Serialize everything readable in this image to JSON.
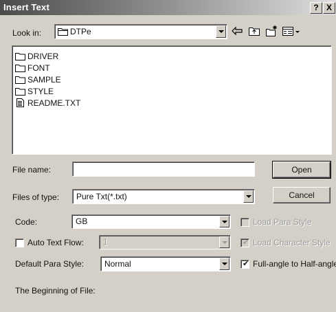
{
  "window": {
    "title": "Insert Text",
    "help_label": "?",
    "close_label": "X"
  },
  "look_in": {
    "label": "Look in:",
    "folder": "DTPe"
  },
  "toolbar_icons": [
    "back-arrow-icon",
    "up-folder-icon",
    "new-folder-icon",
    "view-menu-icon"
  ],
  "files": [
    {
      "name": "DRIVER",
      "type": "folder"
    },
    {
      "name": "FONT",
      "type": "folder"
    },
    {
      "name": "SAMPLE",
      "type": "folder"
    },
    {
      "name": "STYLE",
      "type": "folder"
    },
    {
      "name": "README.TXT",
      "type": "text-file"
    }
  ],
  "file_name": {
    "label": "File name:",
    "value": ""
  },
  "file_type": {
    "label": "Files of type:",
    "value": "Pure Txt(*.txt)"
  },
  "buttons": {
    "open": "Open",
    "cancel": "Cancel"
  },
  "code": {
    "label": "Code:",
    "value": "GB"
  },
  "load_para_style": {
    "label": "Load Para Style",
    "checked": false,
    "enabled": false
  },
  "auto_text_flow": {
    "label": "Auto Text Flow:",
    "checked": false,
    "value": "1",
    "enabled": false
  },
  "load_character_style": {
    "label": "Load Character Style",
    "checked": true,
    "enabled": false
  },
  "default_para_style": {
    "label": "Default Para Style:",
    "value": "Normal"
  },
  "full_angle": {
    "label": "Full-angle to Half-angle",
    "checked": true
  },
  "beginning_of_file": {
    "label": "The Beginning of File:"
  },
  "colors": {
    "dialog_bg": "#d4d0c8",
    "title_start": "#4c4c4c",
    "title_end": "#dedede"
  }
}
